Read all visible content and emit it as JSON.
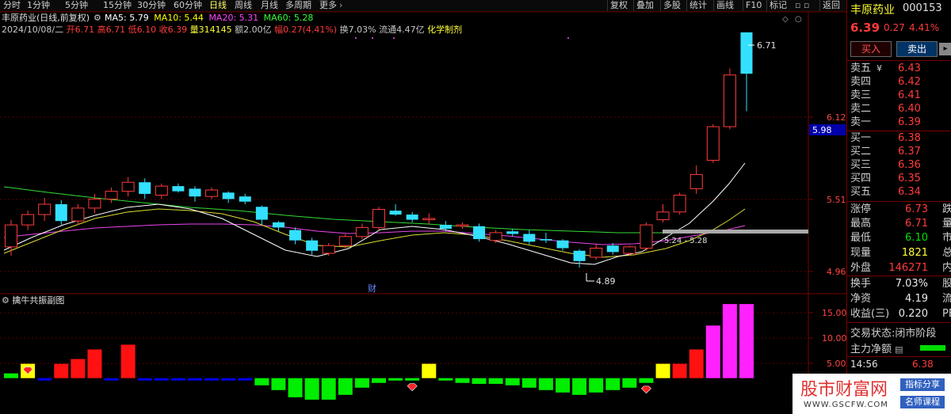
{
  "toolbar": {
    "periods": [
      "分时",
      "1分钟",
      "5分钟",
      "15分钟",
      "30分钟",
      "60分钟",
      "日线",
      "周线",
      "月线",
      "多周期",
      "更多"
    ],
    "active_period": "日线",
    "right_buttons": [
      "复权",
      "叠加",
      "多股",
      "统计",
      "画线",
      "F10",
      "标记",
      "返回"
    ]
  },
  "header": {
    "title": "丰原药业(日线,前复权)",
    "ma_legend": [
      {
        "label": "MA5: 5.79",
        "color": "#ffffff"
      },
      {
        "label": "MA10: 5.44",
        "color": "#ffff00"
      },
      {
        "label": "MA20: 5.31",
        "color": "#ff44ff"
      },
      {
        "label": "MA60: 5.28",
        "color": "#33ff33"
      }
    ],
    "info_line": [
      {
        "text": "2024/10/08/二",
        "color": "#c8c8c8"
      },
      {
        "text": "开6.71",
        "color": "#ff3b3b"
      },
      {
        "text": "高6.71",
        "color": "#ff3b3b"
      },
      {
        "text": "低6.10",
        "color": "#ff3b3b"
      },
      {
        "text": "收6.39",
        "color": "#ff3b3b"
      },
      {
        "text": "量314145",
        "color": "#ffff33"
      },
      {
        "text": "额2.00亿",
        "color": "#c8c8c8"
      },
      {
        "text": "幅0.27(4.41%)",
        "color": "#ff3b3b"
      },
      {
        "text": "换7.03%",
        "color": "#c8c8c8"
      },
      {
        "text": "流通4.47亿",
        "color": "#c8c8c8"
      },
      {
        "text": "化学制剂",
        "color": "#ffff33"
      }
    ]
  },
  "price_axis": {
    "labels": [
      "6.12",
      "5.51",
      "4.96"
    ],
    "current_tag": "5.98"
  },
  "annotations": {
    "high": "6.71",
    "low": "4.89",
    "range": "5.24 - 5.28",
    "finance_mark": "财"
  },
  "indicator": {
    "title": "擒牛共振副图",
    "axis_labels": [
      "15.00",
      "10.00",
      "5.00"
    ]
  },
  "chart_data": {
    "type": "candlestick",
    "y_range": [
      4.7,
      6.85
    ],
    "candles": [
      {
        "o": 5.05,
        "c": 5.22,
        "h": 5.26,
        "l": 4.98
      },
      {
        "o": 5.22,
        "c": 5.3,
        "h": 5.33,
        "l": 5.18
      },
      {
        "o": 5.3,
        "c": 5.38,
        "h": 5.43,
        "l": 5.25
      },
      {
        "o": 5.38,
        "c": 5.25,
        "h": 5.41,
        "l": 5.22
      },
      {
        "o": 5.25,
        "c": 5.35,
        "h": 5.38,
        "l": 5.22
      },
      {
        "o": 5.35,
        "c": 5.42,
        "h": 5.46,
        "l": 5.31
      },
      {
        "o": 5.42,
        "c": 5.48,
        "h": 5.51,
        "l": 5.39
      },
      {
        "o": 5.48,
        "c": 5.55,
        "h": 5.59,
        "l": 5.44
      },
      {
        "o": 5.55,
        "c": 5.46,
        "h": 5.58,
        "l": 5.42
      },
      {
        "o": 5.45,
        "c": 5.52,
        "h": 5.54,
        "l": 5.42
      },
      {
        "o": 5.52,
        "c": 5.48,
        "h": 5.54,
        "l": 5.47
      },
      {
        "o": 5.5,
        "c": 5.44,
        "h": 5.52,
        "l": 5.4
      },
      {
        "o": 5.44,
        "c": 5.49,
        "h": 5.51,
        "l": 5.42
      },
      {
        "o": 5.47,
        "c": 5.42,
        "h": 5.48,
        "l": 5.39
      },
      {
        "o": 5.44,
        "c": 5.4,
        "h": 5.46,
        "l": 5.38
      },
      {
        "o": 5.36,
        "c": 5.26,
        "h": 5.37,
        "l": 5.22
      },
      {
        "o": 5.24,
        "c": 5.2,
        "h": 5.25,
        "l": 5.17
      },
      {
        "o": 5.18,
        "c": 5.1,
        "h": 5.2,
        "l": 5.07
      },
      {
        "o": 5.1,
        "c": 5.02,
        "h": 5.12,
        "l": 4.99
      },
      {
        "o": 5.0,
        "c": 5.06,
        "h": 5.08,
        "l": 4.98
      },
      {
        "o": 5.06,
        "c": 5.13,
        "h": 5.15,
        "l": 5.04
      },
      {
        "o": 5.13,
        "c": 5.2,
        "h": 5.23,
        "l": 5.11
      },
      {
        "o": 5.2,
        "c": 5.34,
        "h": 5.36,
        "l": 5.18
      },
      {
        "o": 5.33,
        "c": 5.3,
        "h": 5.38,
        "l": 5.29
      },
      {
        "o": 5.3,
        "c": 5.26,
        "h": 5.32,
        "l": 5.24
      },
      {
        "o": 5.26,
        "c": 5.27,
        "h": 5.31,
        "l": 5.23
      },
      {
        "o": 5.22,
        "c": 5.19,
        "h": 5.25,
        "l": 5.17
      },
      {
        "o": 5.21,
        "c": 5.22,
        "h": 5.24,
        "l": 5.19
      },
      {
        "o": 5.21,
        "c": 5.11,
        "h": 5.23,
        "l": 5.09
      },
      {
        "o": 5.1,
        "c": 5.16,
        "h": 5.18,
        "l": 5.08
      },
      {
        "o": 5.17,
        "c": 5.15,
        "h": 5.19,
        "l": 5.13
      },
      {
        "o": 5.15,
        "c": 5.09,
        "h": 5.18,
        "l": 5.07
      },
      {
        "o": 5.11,
        "c": 5.1,
        "h": 5.16,
        "l": 5.08
      },
      {
        "o": 5.1,
        "c": 5.04,
        "h": 5.11,
        "l": 5.02
      },
      {
        "o": 5.02,
        "c": 4.94,
        "h": 5.03,
        "l": 4.89
      },
      {
        "o": 4.97,
        "c": 5.04,
        "h": 5.07,
        "l": 4.95
      },
      {
        "o": 5.06,
        "c": 5.01,
        "h": 5.08,
        "l": 4.99
      },
      {
        "o": 5.0,
        "c": 5.05,
        "h": 5.06,
        "l": 4.98
      },
      {
        "o": 5.04,
        "c": 5.22,
        "h": 5.24,
        "l": 5.02
      },
      {
        "o": 5.26,
        "c": 5.32,
        "h": 5.38,
        "l": 5.24
      },
      {
        "o": 5.32,
        "c": 5.45,
        "h": 5.47,
        "l": 5.3
      },
      {
        "o": 5.5,
        "c": 5.61,
        "h": 5.68,
        "l": 5.46
      },
      {
        "o": 5.72,
        "c": 5.98,
        "h": 6.0,
        "l": 5.7
      },
      {
        "o": 5.98,
        "c": 6.38,
        "h": 6.43,
        "l": 5.96
      },
      {
        "o": 6.71,
        "c": 6.39,
        "h": 6.71,
        "l": 6.1
      }
    ],
    "indicator_bars": [
      1,
      3,
      -0.5,
      3,
      4,
      6,
      -0.5,
      7,
      -0.5,
      -0.5,
      -0.5,
      -0.5,
      -0.5,
      -0.5,
      -0.5,
      -1.5,
      -2.5,
      -4,
      -4.5,
      -4.5,
      -3.5,
      -2,
      -1,
      -0.5,
      -0.5,
      3,
      -0.5,
      -1,
      -1.2,
      -1.2,
      -1.5,
      -2,
      -2.5,
      -3,
      -3.5,
      -3,
      -2.5,
      -2,
      -1,
      3,
      3,
      6,
      11,
      15.5,
      15.5
    ],
    "indicator_bar_colors": [
      "green",
      "yellow",
      "blue",
      "red",
      "red",
      "red",
      "blue",
      "red",
      "blue",
      "blue",
      "blue",
      "blue",
      "blue",
      "blue",
      "blue",
      "green",
      "green",
      "green",
      "green",
      "green",
      "green",
      "green",
      "green",
      "green",
      "green",
      "yellow",
      "green",
      "green",
      "green",
      "green",
      "green",
      "green",
      "green",
      "green",
      "green",
      "green",
      "green",
      "green",
      "green",
      "yellow",
      "red",
      "red",
      "magenta",
      "magenta",
      "magenta"
    ],
    "diamond_markers": [
      1,
      24,
      38
    ],
    "indicator_y_range": [
      -7.5,
      17.5
    ]
  },
  "stock": {
    "name": "丰原药业",
    "code": "000153",
    "price": "6.39",
    "change": "0.27",
    "change_pct": "4.41%",
    "buy_button": "买入",
    "sell_button": "卖出"
  },
  "asks": [
    {
      "label": "卖五",
      "price": "6.43"
    },
    {
      "label": "卖四",
      "price": "6.42"
    },
    {
      "label": "卖三",
      "price": "6.41"
    },
    {
      "label": "卖二",
      "price": "6.40"
    },
    {
      "label": "卖一",
      "price": "6.39"
    }
  ],
  "bids": [
    {
      "label": "买一",
      "price": "6.38"
    },
    {
      "label": "买二",
      "price": "6.37"
    },
    {
      "label": "买三",
      "price": "6.36"
    },
    {
      "label": "买四",
      "price": "6.35"
    },
    {
      "label": "买五",
      "price": "6.34"
    }
  ],
  "stats": [
    {
      "label": "涨停",
      "value": "6.73",
      "color": "#ff3b3b",
      "extra": "跌"
    },
    {
      "label": "最高",
      "value": "6.71",
      "color": "#ff3b3b",
      "extra": "量"
    },
    {
      "label": "最低",
      "value": "6.10",
      "color": "#00e000",
      "extra": "市"
    },
    {
      "label": "现量",
      "value": "1821",
      "color": "#ffff33",
      "extra": "总"
    },
    {
      "label": "外盘",
      "value": "146271",
      "color": "#ff3b3b",
      "extra": "内"
    },
    {
      "label": "换手",
      "value": "7.03%",
      "color": "#e8e8e8",
      "extra": "股"
    },
    {
      "label": "净资",
      "value": "4.19",
      "color": "#e8e8e8",
      "extra": "流"
    },
    {
      "label": "收益(三)",
      "value": "0.220",
      "color": "#e8e8e8",
      "extra": "PE"
    }
  ],
  "status": {
    "trade_state_label": "交易状态:",
    "trade_state_value": "闭市阶段",
    "main_force_label": "主力净额",
    "time": "14:56",
    "time_price": "6.38"
  },
  "watermark": {
    "site_name": "股市财富网",
    "url": "WWW.GSCFW.COM",
    "tag1": "指标分享",
    "tag2": "名师课程"
  }
}
